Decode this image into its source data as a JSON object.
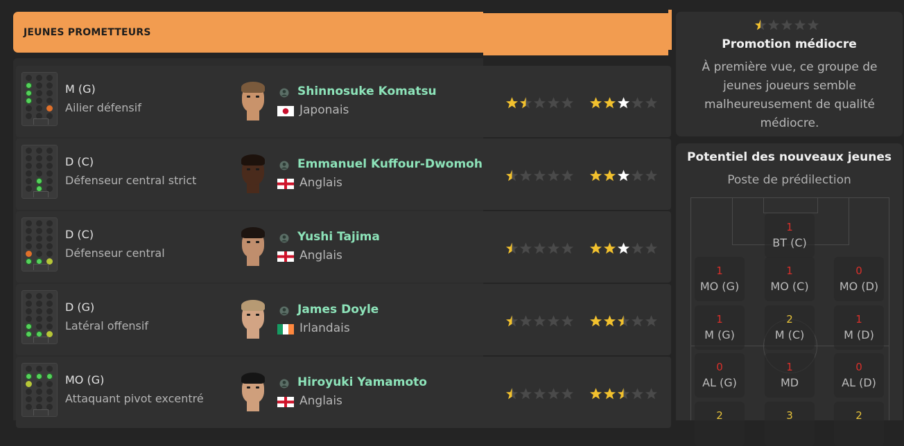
{
  "header": {
    "title": "JEUNES PROMETTEURS"
  },
  "players": [
    {
      "position": "M (G)",
      "role": "Ailier défensif",
      "name": "Shinnosuke Komatsu",
      "nationality": "Japonais",
      "flag": "japan",
      "current_ability_stars": 1.5,
      "potential_stars": 3,
      "face": {
        "skin": "#c9936b",
        "hair": "#7a5a3c"
      },
      "pitch_dots": {
        "g": [
          "0-1",
          "0-2",
          "0-3"
        ],
        "o": [
          "3-3"
        ]
      }
    },
    {
      "position": "D (C)",
      "role": "Défenseur central strict",
      "name": "Emmanuel Kuffour-Dwomoh",
      "nationality": "Anglais",
      "flag": "england",
      "current_ability_stars": 0.5,
      "potential_stars": 3,
      "face": {
        "skin": "#4a2b1c",
        "hair": "#1d120c"
      },
      "pitch_dots": {
        "g": [
          "1-4",
          "1-5"
        ]
      }
    },
    {
      "position": "D (C)",
      "role": "Défenseur central",
      "name": "Yushi Tajima",
      "nationality": "Anglais",
      "flag": "england",
      "current_ability_stars": 0.5,
      "potential_stars": 3,
      "face": {
        "skin": "#c08e6d",
        "hair": "#1c1410"
      },
      "pitch_dots": {
        "o": [
          "0-4"
        ],
        "g": [
          "0-5",
          "1-5"
        ],
        "y": [
          "2-5"
        ]
      }
    },
    {
      "position": "D (G)",
      "role": "Latéral offensif",
      "name": "James Doyle",
      "nationality": "Irlandais",
      "flag": "ireland",
      "current_ability_stars": 0.5,
      "potential_stars": 2.5,
      "face": {
        "skin": "#d2a484",
        "hair": "#b79a73"
      },
      "pitch_dots": {
        "g": [
          "0-4",
          "0-5",
          "1-5"
        ],
        "y": [
          "2-5"
        ]
      }
    },
    {
      "position": "MO (G)",
      "role": "Attaquant pivot excentré",
      "name": "Hiroyuki Yamamoto",
      "nationality": "Anglais",
      "flag": "england",
      "current_ability_stars": 0.5,
      "potential_stars": 2.5,
      "face": {
        "skin": "#cf9f7c",
        "hair": "#151515"
      },
      "pitch_dots": {
        "g": [
          "0-1",
          "1-1",
          "2-1"
        ],
        "y": [
          "0-2"
        ]
      }
    }
  ],
  "promotion": {
    "rating_stars": 0.5,
    "title": "Promotion médiocre",
    "description": "À première vue, ce groupe de jeunes joueurs semble malheureusement de qualité médiocre."
  },
  "potential": {
    "title": "Potentiel des nouveaux jeunes",
    "subtitle": "Poste de prédilection",
    "tiles": [
      {
        "count": "1",
        "label": "BT (C)",
        "color": "red"
      },
      {
        "count": "1",
        "label": "MO (G)",
        "color": "red"
      },
      {
        "count": "1",
        "label": "MO (C)",
        "color": "red"
      },
      {
        "count": "0",
        "label": "MO (D)",
        "color": "red"
      },
      {
        "count": "1",
        "label": "M (G)",
        "color": "red"
      },
      {
        "count": "2",
        "label": "M (C)",
        "color": "yellow"
      },
      {
        "count": "1",
        "label": "M (D)",
        "color": "red"
      },
      {
        "count": "0",
        "label": "AL (G)",
        "color": "red"
      },
      {
        "count": "1",
        "label": "MD",
        "color": "red"
      },
      {
        "count": "0",
        "label": "AL (D)",
        "color": "red"
      },
      {
        "count": "2",
        "label": "",
        "color": "yellow"
      },
      {
        "count": "3",
        "label": "",
        "color": "yellow"
      },
      {
        "count": "2",
        "label": "",
        "color": "yellow"
      }
    ]
  },
  "colors": {
    "accent": "#f29c50",
    "name_green": "#8de3b9",
    "star_gold": "#f2c12e",
    "star_white": "#ffffff",
    "star_empty": "#4a4a4a"
  }
}
